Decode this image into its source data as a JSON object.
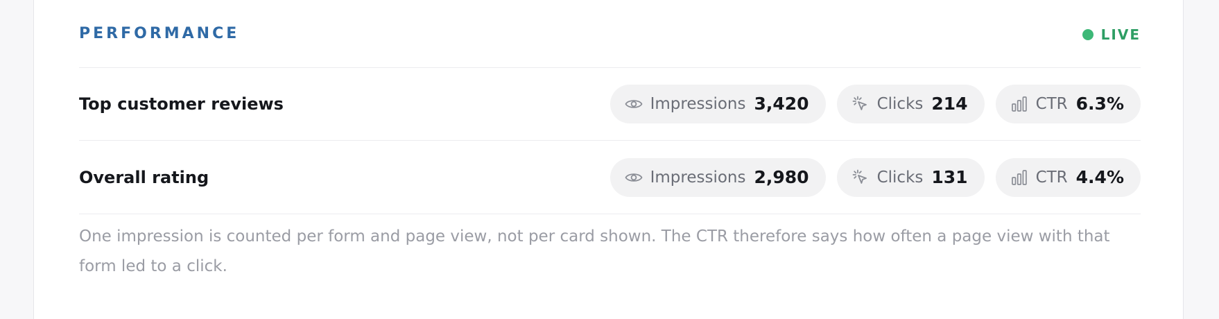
{
  "header": {
    "title": "PERFORMANCE",
    "status": "LIVE",
    "status_color": "#3db877"
  },
  "rows": [
    {
      "label": "Top customer reviews",
      "impressions_label": "Impressions",
      "impressions_value": "3,420",
      "clicks_label": "Clicks",
      "clicks_value": "214",
      "ctr_label": "CTR",
      "ctr_value": "6.3%"
    },
    {
      "label": "Overall rating",
      "impressions_label": "Impressions",
      "impressions_value": "2,980",
      "clicks_label": "Clicks",
      "clicks_value": "131",
      "ctr_label": "CTR",
      "ctr_value": "4.4%"
    }
  ],
  "icons": {
    "impressions": "eye-icon",
    "clicks": "cursor-click-icon",
    "ctr": "bar-chart-icon"
  },
  "note": "One impression is counted per form and page view, not per card shown. The CTR therefore says how often a page view with that form led to a click.",
  "colors": {
    "accent": "#2f6aa6",
    "live": "#2e9e64",
    "muted": "#9a9ca4"
  }
}
